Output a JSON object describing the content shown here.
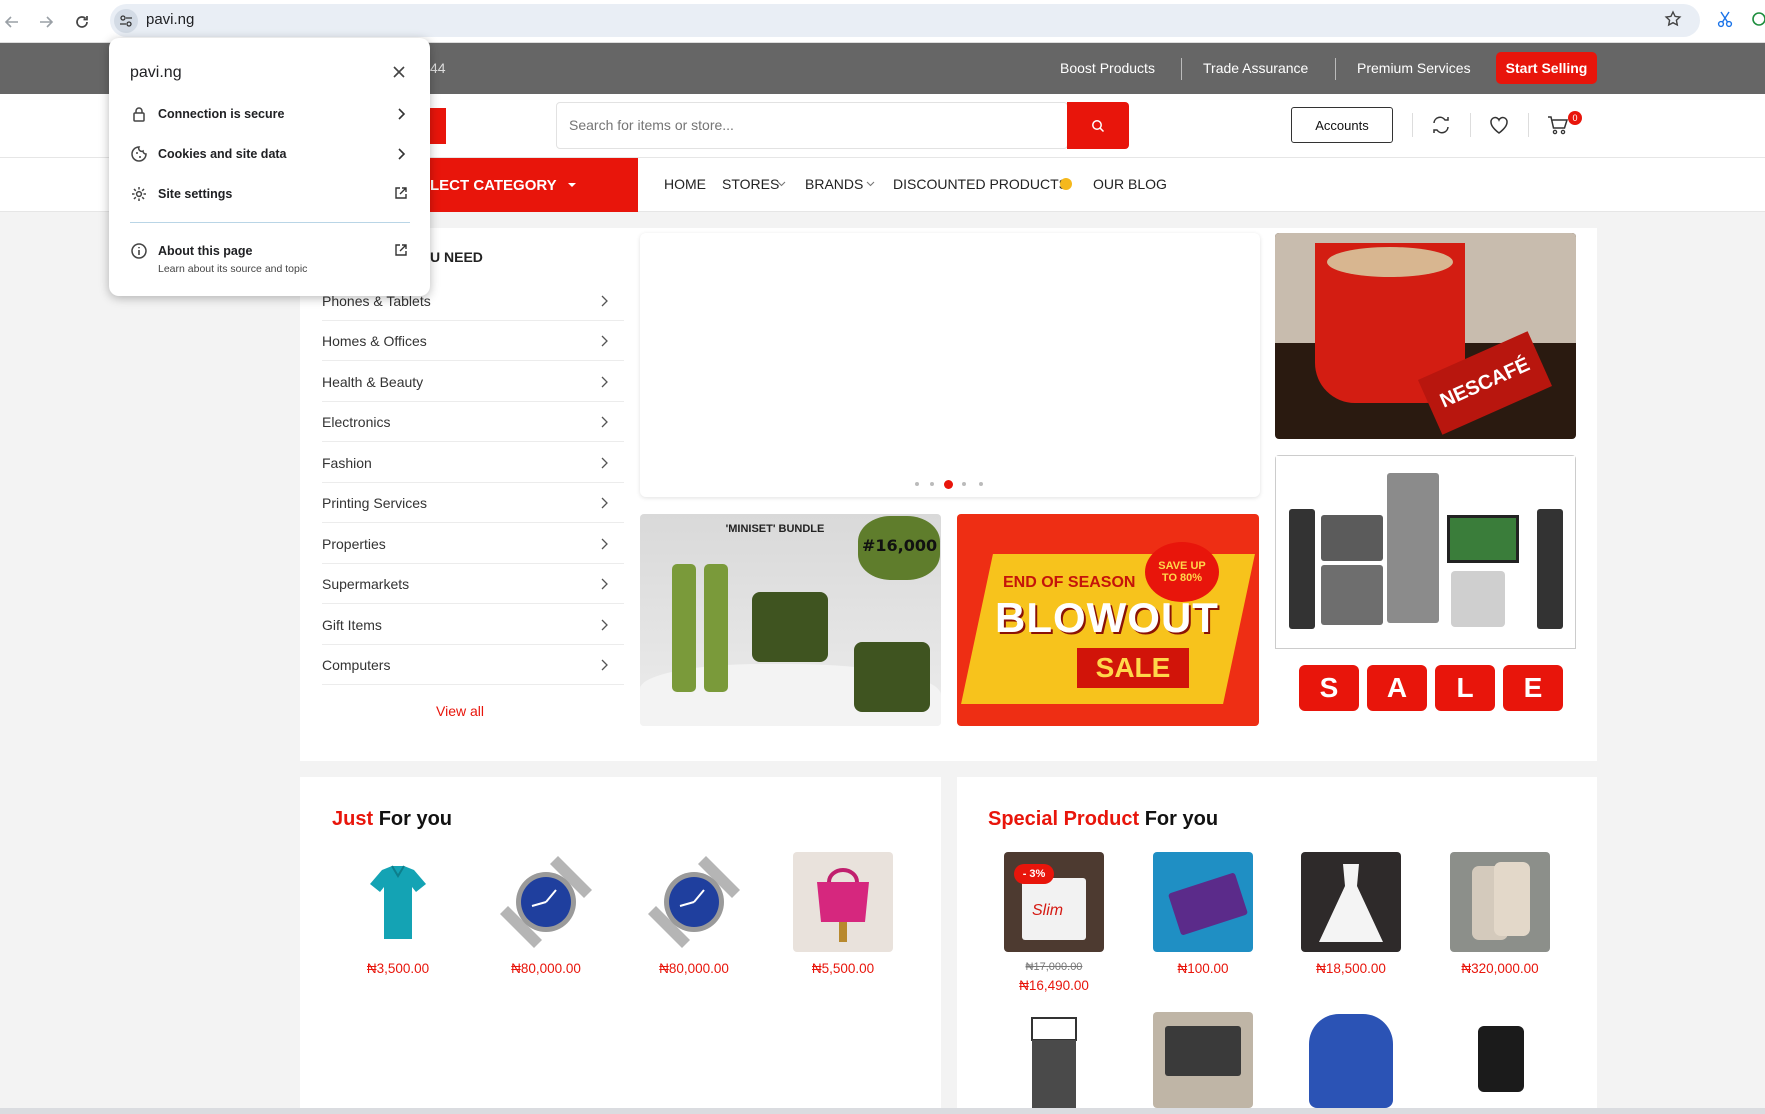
{
  "browser": {
    "url": "pavi.ng",
    "back_icon": "arrow-left-icon",
    "forward_icon": "arrow-right-icon",
    "reload_icon": "reload-icon",
    "star_icon": "bookmark-star-icon"
  },
  "site_info_popup": {
    "title": "pavi.ng",
    "items": [
      {
        "label": "Connection is secure",
        "icon": "lock-icon"
      },
      {
        "label": "Cookies and site data",
        "icon": "cookie-icon"
      },
      {
        "label": "Site settings",
        "icon": "gear-icon"
      }
    ],
    "about": {
      "label": "About this page",
      "sub": "Learn about its source and topic"
    }
  },
  "topbar": {
    "phone_fragment": "44",
    "links": [
      "Boost Products",
      "Trade Assurance",
      "Premium Services"
    ],
    "start_selling": "Start Selling"
  },
  "header": {
    "search_placeholder": "Search for items or store...",
    "accounts": "Accounts",
    "cart_count": "0"
  },
  "nav": {
    "select_category": "LECT CATEGORY",
    "links": [
      "HOME",
      "STORES",
      "BRANDS",
      "DISCOUNTED PRODUCTS",
      "OUR BLOG"
    ]
  },
  "categories": {
    "heading_fragment": "U NEED",
    "items": [
      "Phones & Tablets",
      "Homes & Offices",
      "Health & Beauty",
      "Electronics",
      "Fashion",
      "Printing Services",
      "Properties",
      "Supermarkets",
      "Gift Items",
      "Computers"
    ],
    "view_all": "View all"
  },
  "banners": {
    "miniset_title": "'MINISET' BUNDLE",
    "miniset_price": "#16,000",
    "blowout_top": "END OF SEASON",
    "blowout_main": "BLOWOUT",
    "blowout_sale": "SALE",
    "blowout_badge": "SAVE UP TO 80%",
    "nescafe": "NESCAFÉ",
    "sale_letters": [
      "S",
      "A",
      "L",
      "E"
    ]
  },
  "just_for_you": {
    "title_red": "Just",
    "title_rest": "For you",
    "products": [
      {
        "price": "₦3,500.00",
        "icon": "polo-shirt-icon"
      },
      {
        "price": "₦80,000.00",
        "icon": "watch-icon"
      },
      {
        "price": "₦80,000.00",
        "icon": "watch-icon"
      },
      {
        "price": "₦5,500.00",
        "icon": "handbag-icon"
      }
    ]
  },
  "special_product": {
    "title_red": "Special Product",
    "title_rest": "For you",
    "products": [
      {
        "price": "₦16,490.00",
        "old_price": "₦17,000.00",
        "discount": "- 3%",
        "box_text": "Slim"
      },
      {
        "price": "₦100.00"
      },
      {
        "price": "₦18,500.00"
      },
      {
        "price": "₦320,000.00"
      }
    ]
  },
  "colors": {
    "accent": "#e8150b",
    "topbar": "#666666"
  }
}
